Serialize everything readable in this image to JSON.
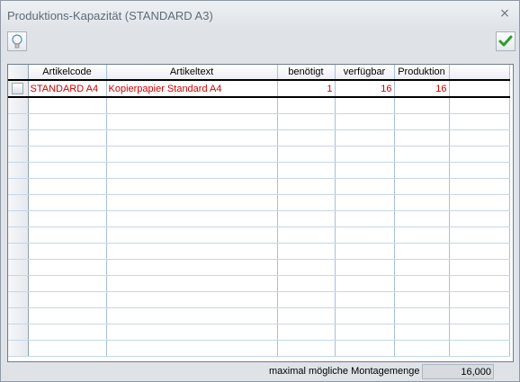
{
  "window": {
    "title": "Produktions-Kapazität (STANDARD A3)",
    "close_label": "×"
  },
  "toolbar": {
    "hint_icon": "lightbulb-icon",
    "ok_icon": "checkmark-icon"
  },
  "table": {
    "columns": [
      "",
      "Artikelcode",
      "Artikeltext",
      "benötigt",
      "verfügbar",
      "Produktion",
      ""
    ],
    "rows": [
      {
        "code": "STANDARD A4",
        "text": "Kopierpapier Standard A4",
        "needed": "1",
        "available": "16",
        "production": "16"
      }
    ],
    "selected_row_color": "#d00000"
  },
  "footer": {
    "label": "maximal mögliche Montagemenge",
    "value": "16,000"
  }
}
